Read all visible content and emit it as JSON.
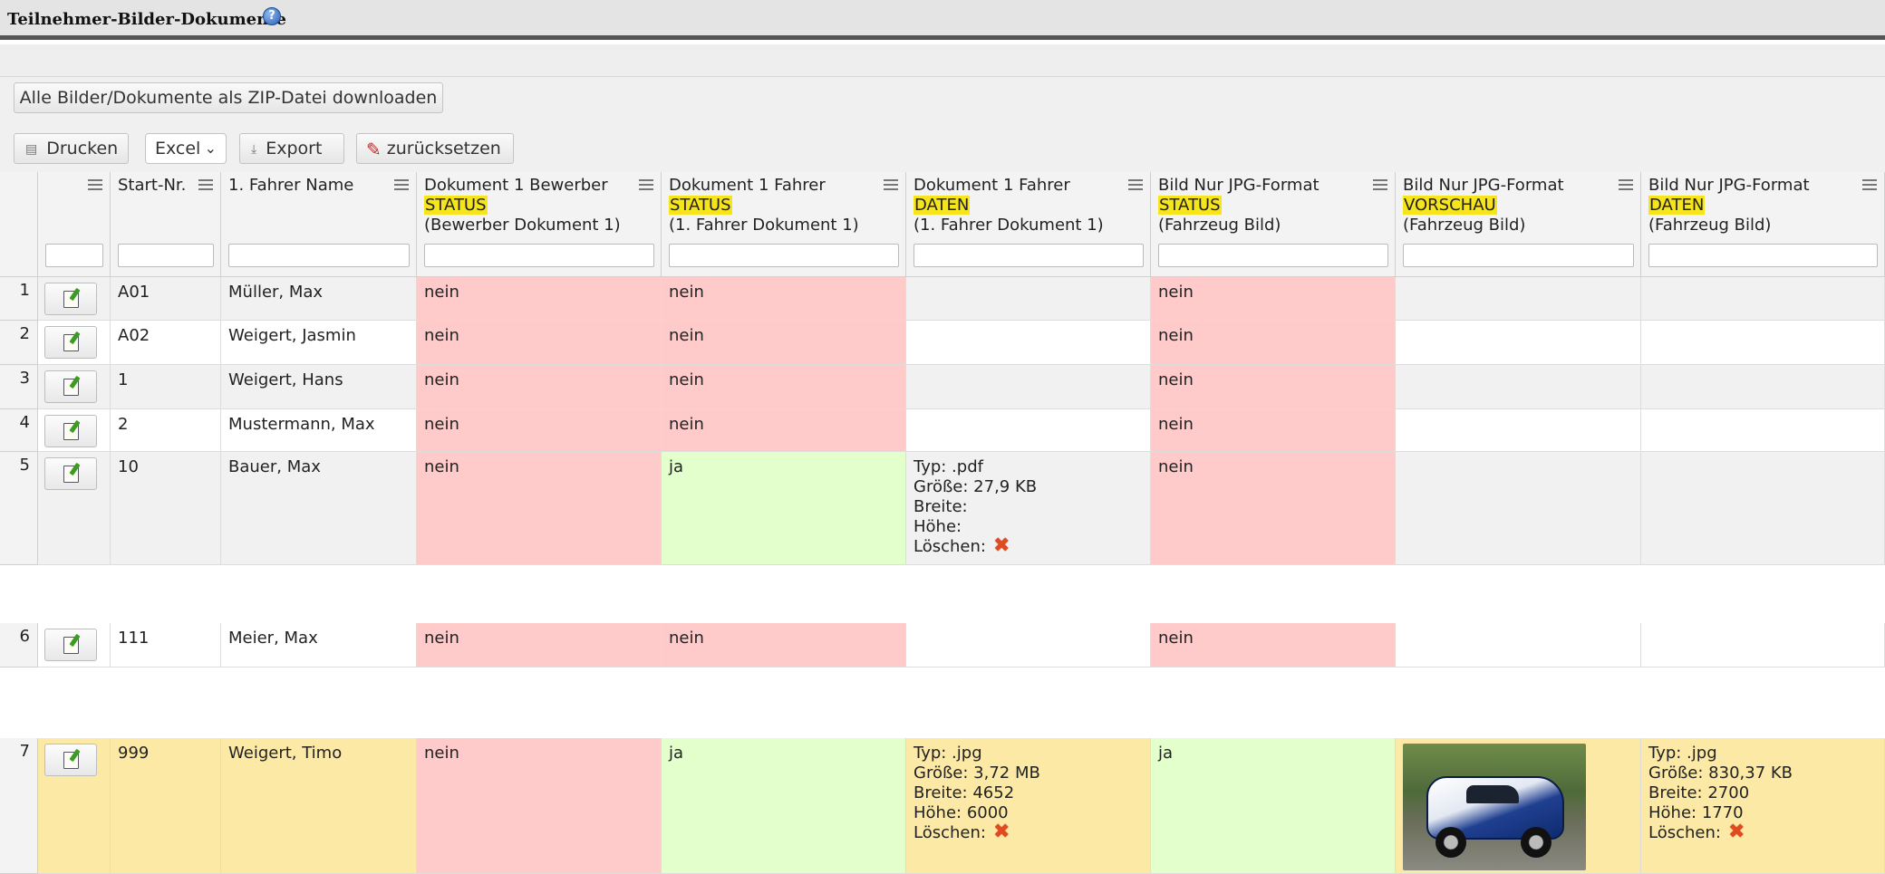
{
  "header": {
    "title": "Teilnehmer-Bilder-Dokumente",
    "help_icon": "?"
  },
  "toolbar": {
    "zip_label": "Alle Bilder/Dokumente als ZIP-Datei downloaden",
    "print_label": "Drucken",
    "format_value": "Excel",
    "export_label": "Export",
    "reset_label": "zurücksetzen",
    "icons": {
      "print": "printer-icon",
      "export": "download-icon",
      "reset": "reset-filter-icon"
    }
  },
  "table": {
    "columns": [
      {
        "line1": "",
        "line2": "",
        "line3": ""
      },
      {
        "line1": "Start-Nr.",
        "line2": "",
        "line3": ""
      },
      {
        "line1": "1. Fahrer Name",
        "line2": "",
        "line3": ""
      },
      {
        "line1": "Dokument 1 Bewerber",
        "line2": "STATUS",
        "line3": "(Bewerber Dokument 1)"
      },
      {
        "line1": "Dokument 1 Fahrer",
        "line2": "STATUS",
        "line3": "(1. Fahrer Dokument 1)"
      },
      {
        "line1": "Dokument 1 Fahrer",
        "line2": "DATEN",
        "line3": "(1. Fahrer Dokument 1)"
      },
      {
        "line1": "Bild Nur JPG-Format",
        "line2": "STATUS",
        "line3": "(Fahrzeug Bild)"
      },
      {
        "line1": "Bild Nur JPG-Format",
        "line2": "VORSCHAU",
        "line3": "(Fahrzeug Bild)"
      },
      {
        "line1": "Bild Nur JPG-Format",
        "line2": "DATEN",
        "line3": "(Fahrzeug Bild)"
      }
    ],
    "rows": [
      {
        "num": "1",
        "start": "A01",
        "name": "Müller, Max",
        "doc_bew": "nein",
        "doc_fahrer": "nein",
        "daten": [],
        "bild_status": "nein",
        "bild_daten": []
      },
      {
        "num": "2",
        "start": "A02",
        "name": "Weigert, Jasmin",
        "doc_bew": "nein",
        "doc_fahrer": "nein",
        "daten": [],
        "bild_status": "nein",
        "bild_daten": []
      },
      {
        "num": "3",
        "start": "1",
        "name": "Weigert, Hans",
        "doc_bew": "nein",
        "doc_fahrer": "nein",
        "daten": [],
        "bild_status": "nein",
        "bild_daten": []
      },
      {
        "num": "4",
        "start": "2",
        "name": "Mustermann, Max",
        "doc_bew": "nein",
        "doc_fahrer": "nein",
        "daten": [],
        "bild_status": "nein",
        "bild_daten": []
      },
      {
        "num": "5",
        "start": "10",
        "name": "Bauer, Max",
        "doc_bew": "nein",
        "doc_fahrer": "ja",
        "daten": [
          "Typ: .pdf",
          "Größe: 27,9 KB",
          "Breite:",
          "Höhe:",
          "Löschen:"
        ],
        "bild_status": "nein",
        "bild_daten": []
      },
      {
        "num": "6",
        "start": "111",
        "name": "Meier, Max",
        "doc_bew": "nein",
        "doc_fahrer": "nein",
        "daten": [],
        "bild_status": "nein",
        "bild_daten": []
      },
      {
        "num": "7",
        "start": "999",
        "name": "Weigert, Timo",
        "doc_bew": "nein",
        "doc_fahrer": "ja",
        "daten": [
          "Typ: .jpg",
          "Größe: 3,72 MB",
          "Breite: 4652",
          "Höhe: 6000",
          "Löschen:"
        ],
        "bild_status": "ja",
        "bild_daten": [
          "Typ: .jpg",
          "Größe: 830,37 KB",
          "Breite: 2700",
          "Höhe: 1770",
          "Löschen:"
        ],
        "has_preview": true
      }
    ]
  },
  "colors": {
    "nein": "#ffcaca",
    "ja": "#e2ffcc",
    "highlight": "#f6e51c",
    "row_selected": "#fde9a6",
    "row_alt": "#f1f1f1"
  }
}
